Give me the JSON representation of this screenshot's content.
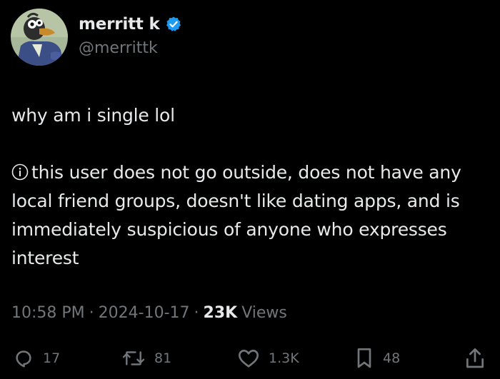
{
  "user": {
    "display_name": "merritt k",
    "handle": "@merrittk",
    "verified": true
  },
  "tweet": {
    "line1": "why am i single lol",
    "info_text": "this user does not go outside, does not have any local friend groups, doesn't like dating apps, and is immediately suspicious of anyone who expresses interest"
  },
  "meta": {
    "time": "10:58 PM",
    "separator": "·",
    "date": "2024-10-17",
    "views_count": "23K",
    "views_label": "Views"
  },
  "actions": {
    "replies": "17",
    "reposts": "81",
    "likes": "1.3K",
    "bookmarks": "48"
  },
  "colors": {
    "background": "#000000",
    "text": "#e7e9ea",
    "secondary": "#71767b",
    "verified": "#1d9bf0"
  },
  "icons": {
    "verified": "verified-badge-icon",
    "info": "info-circle-icon",
    "reply": "reply-icon",
    "repost": "repost-icon",
    "like": "heart-icon",
    "bookmark": "bookmark-icon",
    "share": "share-icon"
  }
}
